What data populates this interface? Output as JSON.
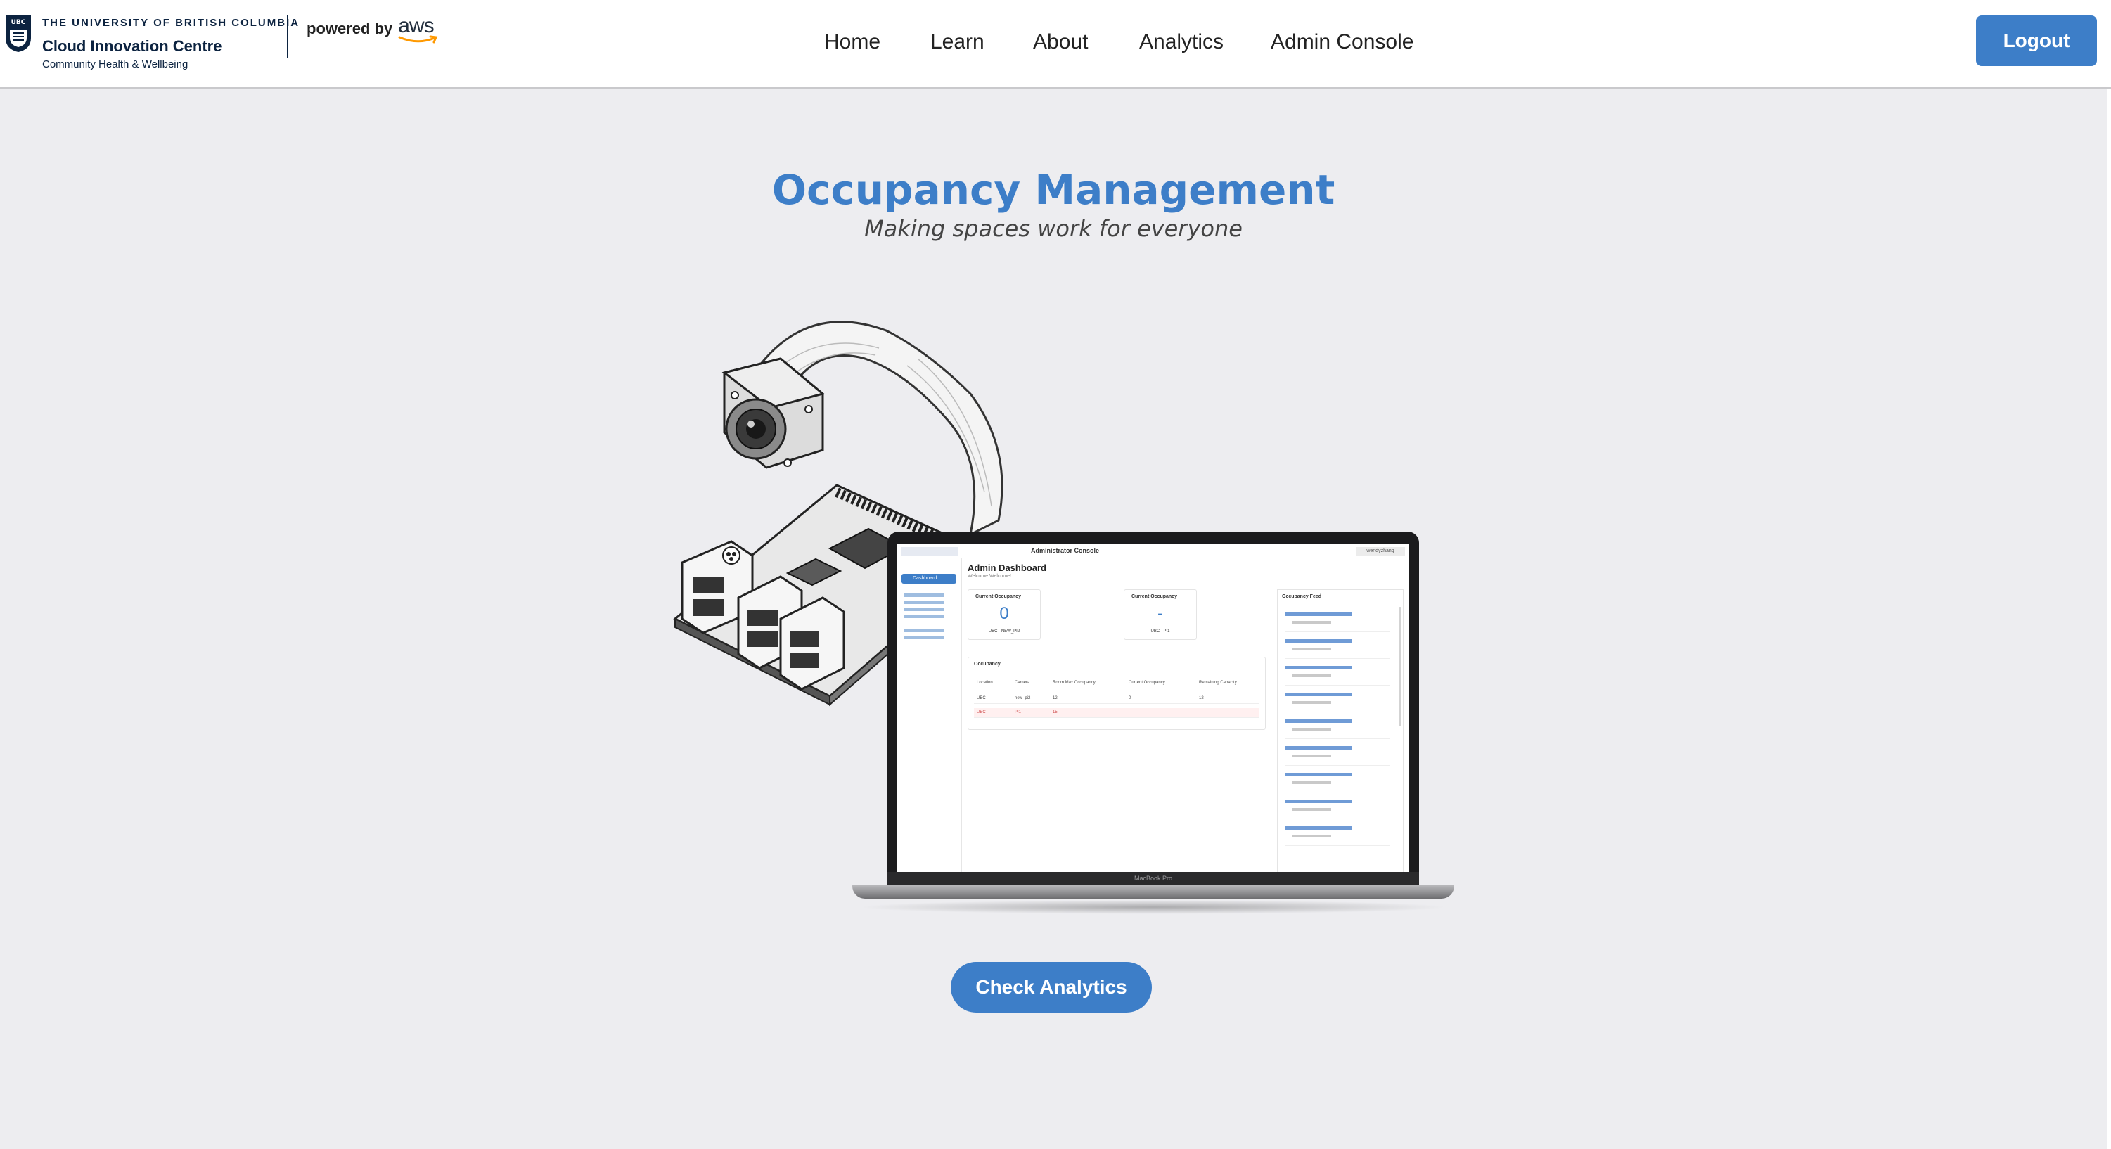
{
  "header": {
    "brand": {
      "university": "THE UNIVERSITY OF BRITISH COLUMBIA",
      "centre": "Cloud Innovation Centre",
      "community": "Community Health & Wellbeing",
      "powered_by": "powered by",
      "aws": "aws"
    },
    "nav": [
      {
        "label": "Home"
      },
      {
        "label": "Learn"
      },
      {
        "label": "About"
      },
      {
        "label": "Analytics"
      },
      {
        "label": "Admin Console"
      }
    ],
    "logout_label": "Logout"
  },
  "hero": {
    "title": "Occupancy Management",
    "subtitle": "Making spaces work for everyone"
  },
  "illustration": {
    "mini_console": {
      "top_title": "Administrator Console",
      "user": "wendyzhang",
      "sidebar_active": "Dashboard",
      "title": "Admin Dashboard",
      "welcome": "Welcome Welcome!",
      "cards": [
        {
          "title": "Current Occupancy",
          "value": "0",
          "label": "UBC - NEW_PI2"
        },
        {
          "title": "Current Occupancy",
          "value": "-",
          "label": "UBC - PI1"
        }
      ],
      "table": {
        "title": "Occupancy",
        "headers": [
          "Location",
          "Camera",
          "Room Max Occupancy",
          "Current Occupancy",
          "Remaining Capacity"
        ],
        "rows": [
          [
            "UBC",
            "new_pi2",
            "12",
            "0",
            "12"
          ],
          [
            "UBC",
            "PI1",
            "15",
            "-",
            "-"
          ]
        ]
      },
      "feed_title": "Occupancy Feed"
    },
    "laptop_label": "MacBook Pro"
  },
  "cta": {
    "label": "Check Analytics"
  },
  "colors": {
    "accent": "#3d7ec8",
    "background": "#ededf0",
    "header_bg": "#ffffff",
    "brand_navy": "#0c2340"
  },
  "icons": [
    "ubc-crest-icon",
    "aws-smile-icon"
  ]
}
